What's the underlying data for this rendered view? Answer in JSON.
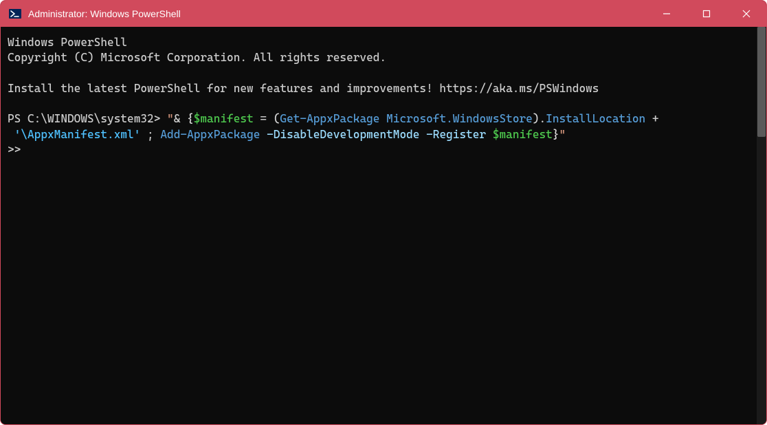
{
  "window": {
    "title": "Administrator: Windows PowerShell"
  },
  "terminal": {
    "header_line1": "Windows PowerShell",
    "header_line2": "Copyright (C) Microsoft Corporation. All rights reserved.",
    "promo": "Install the latest PowerShell for new features and improvements! https://aka.ms/PSWindows",
    "prompt": "PS C:\\WINDOWS\\system32> ",
    "cmd": {
      "dq1": "\"",
      "amp": "& ",
      "brace_open": "{",
      "var1": "$manifest",
      "eq": " = ",
      "paren_open": "(",
      "cmd1": "Get-AppxPackage",
      "sp": " ",
      "arg1": "Microsoft.WindowsStore",
      "paren_close": ")",
      "dot": ".",
      "prop": "InstallLocation",
      "plus": " +",
      "sp_leading": " ",
      "str": "'\\AppxManifest.xml'",
      "semi": " ; ",
      "cmd2": "Add-AppxPackage",
      "param1": " -DisableDevelopmentMode",
      "param2": " -Register",
      "sp2": " ",
      "var2": "$manifest",
      "brace_close": "}",
      "dq2": "\""
    },
    "continuation": ">>"
  },
  "icons": {
    "app": "powershell-icon",
    "minimize": "minimize-icon",
    "maximize": "maximize-icon",
    "close": "close-icon"
  }
}
